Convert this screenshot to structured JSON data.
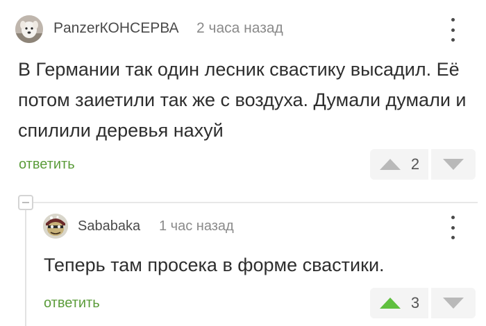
{
  "comments": [
    {
      "author": "PanzerКОНСЕРВА",
      "time": "2 часа назад",
      "text": "В Германии так один лесник свастику высадил. Её потом заиетили так же с воздуха. Думали думали и спилили деревья нахуй",
      "reply_label": "ответить",
      "votes": "2",
      "avatar_icon": "dog-avatar-icon",
      "menu_icon": "more-vertical-icon"
    },
    {
      "author": "Sababaka",
      "time": "1 час назад",
      "text": "Теперь там просека в форме свастики.",
      "reply_label": "ответить",
      "votes": "3",
      "avatar_icon": "cartoon-face-avatar-icon",
      "menu_icon": "more-vertical-icon"
    }
  ],
  "colors": {
    "accent_green": "#5b9c3a",
    "upvote_active": "#5fbf3f",
    "upvote_idle": "#b9b9b9",
    "vote_bg": "#f4f4f4"
  }
}
